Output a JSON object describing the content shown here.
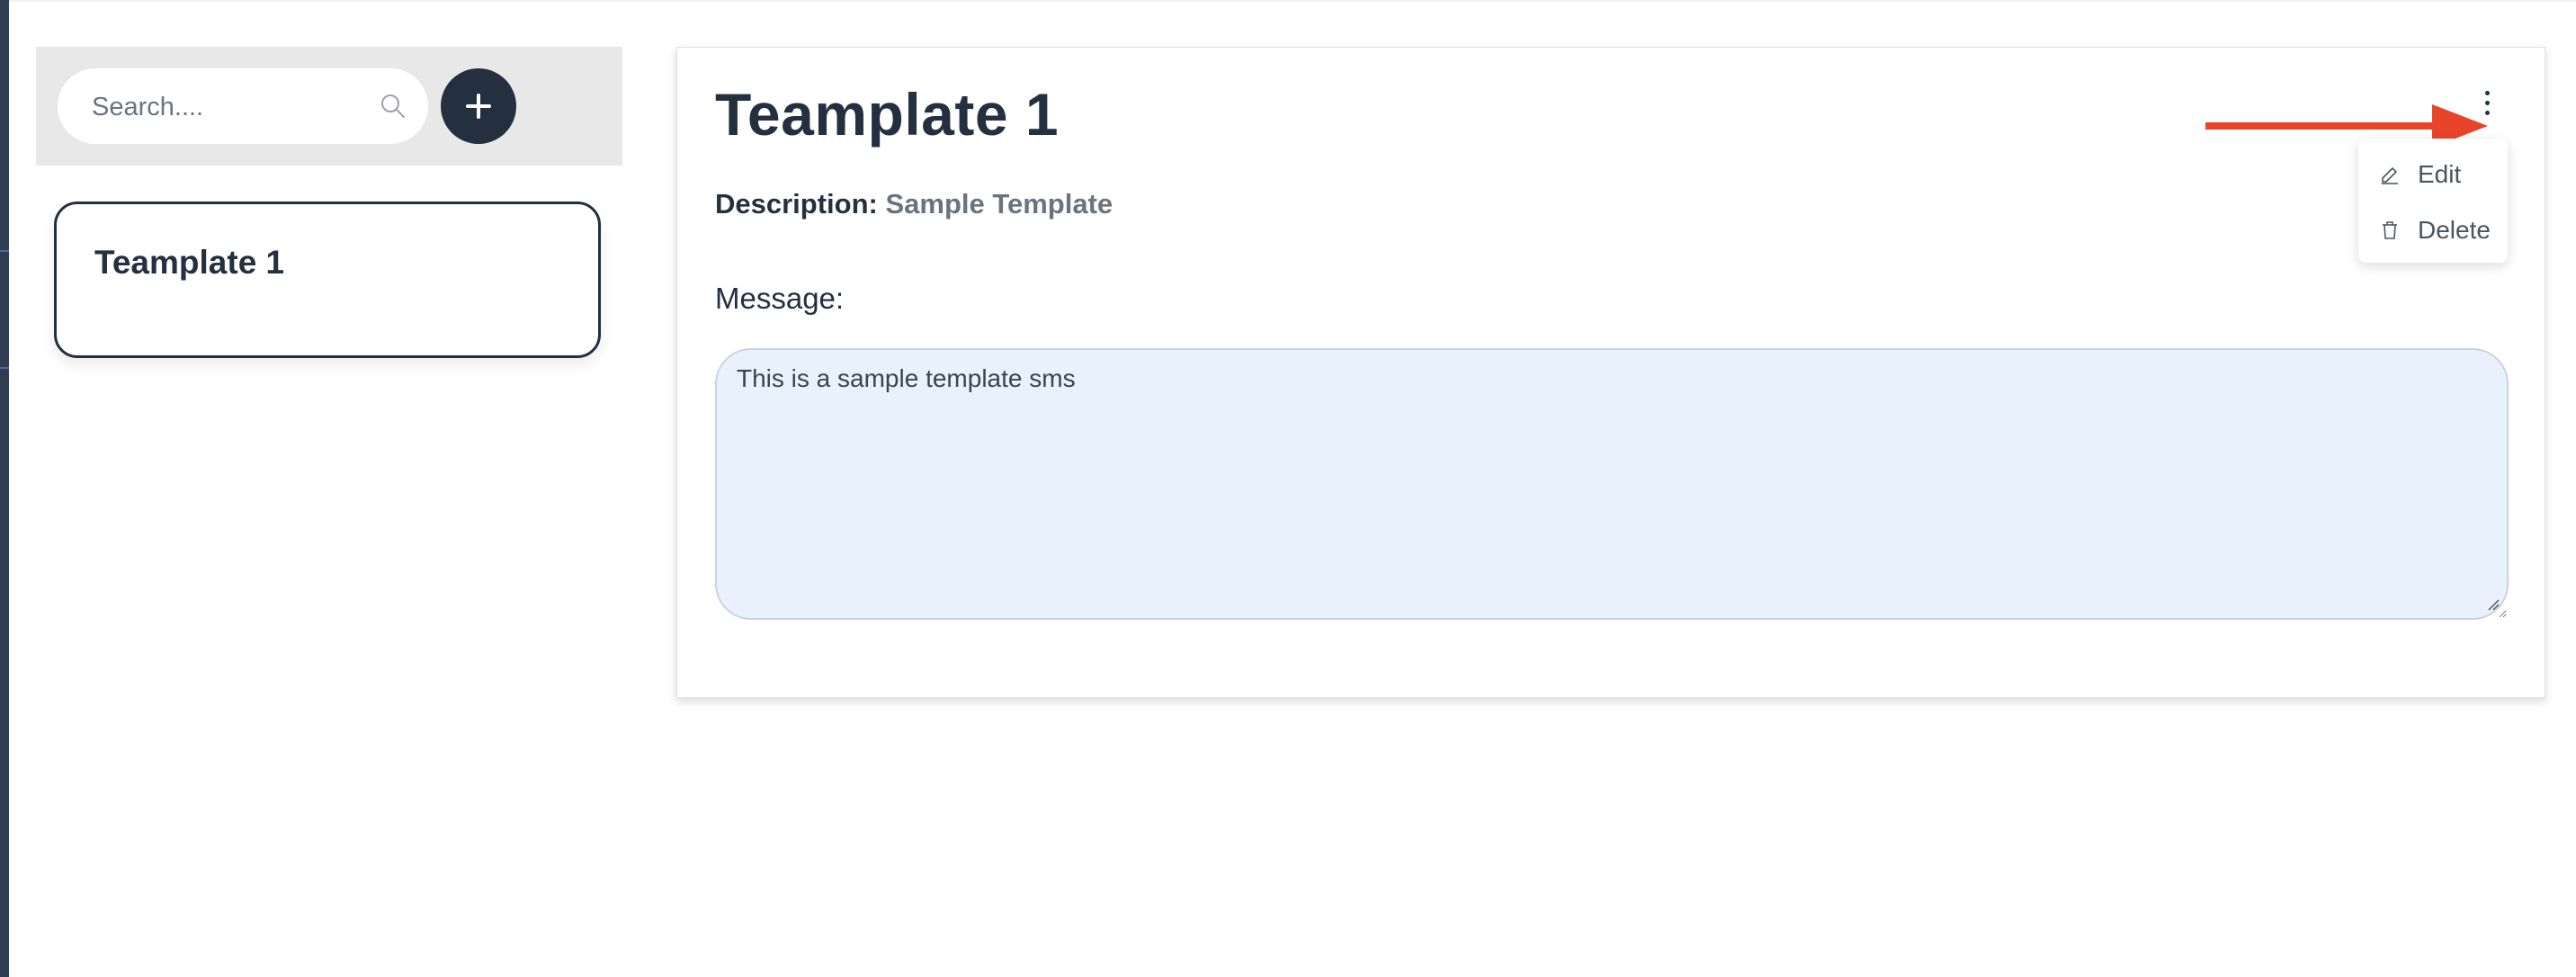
{
  "sidebar": {
    "search": {
      "placeholder": "Search....",
      "icon": "search-icon"
    },
    "add_button": {
      "icon": "plus-icon"
    },
    "templates": [
      {
        "name": "Teamplate 1"
      }
    ]
  },
  "detail": {
    "title": "Teamplate 1",
    "description_label": "Description:",
    "description_value": "Sample Template",
    "message_label": "Message:",
    "message_value": "This is a sample template sms"
  },
  "menu": {
    "items": [
      {
        "label": "Edit",
        "icon": "pencil-icon"
      },
      {
        "label": "Delete",
        "icon": "trash-icon"
      }
    ]
  },
  "colors": {
    "primary": "#243040",
    "sidebar_bg": "#e8e8e8",
    "message_bg": "#e9f1fc",
    "annotation_arrow": "#e8442a"
  }
}
